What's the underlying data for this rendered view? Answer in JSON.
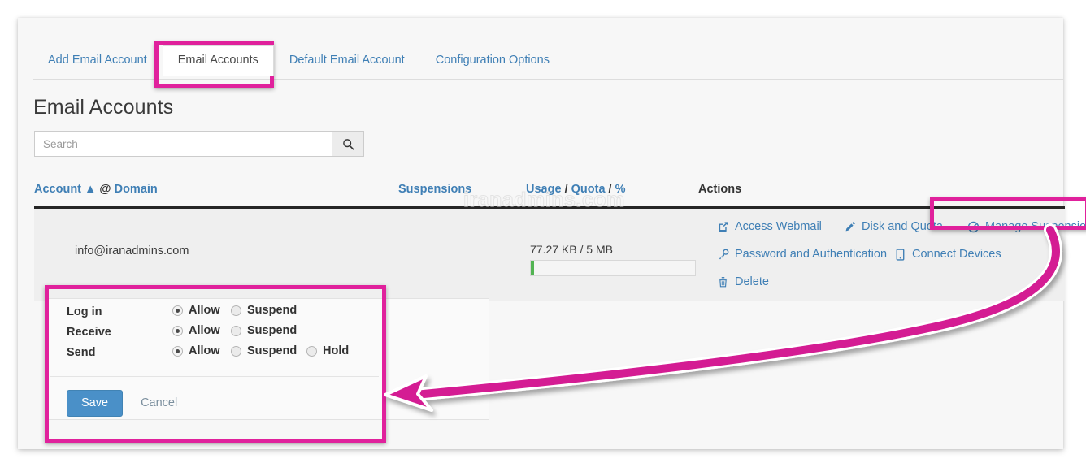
{
  "tabs": [
    {
      "label": "Add Email Account",
      "active": false
    },
    {
      "label": "Email Accounts",
      "active": true
    },
    {
      "label": "Default Email Account",
      "active": false
    },
    {
      "label": "Configuration Options",
      "active": false
    }
  ],
  "page": {
    "title": "Email Accounts",
    "watermark": "iranadmins.com"
  },
  "search": {
    "placeholder": "Search",
    "value": "",
    "icon": "search-icon"
  },
  "table": {
    "headers": {
      "account": "Account ▲",
      "account_at": "@",
      "account_domain": "Domain",
      "suspensions": "Suspensions",
      "usage": "Usage",
      "usage_sep1": "/",
      "quota": "Quota",
      "usage_sep2": "/",
      "percent": "%",
      "actions": "Actions"
    },
    "rows": [
      {
        "email": "info@iranadmins.com",
        "suspensions": "",
        "usage_text": "77.27 KB / 5 MB",
        "usage_percent": 2,
        "actions": [
          {
            "label": "Access Webmail",
            "icon": "external-link-icon"
          },
          {
            "label": "Disk and Quota",
            "icon": "pencil-icon"
          },
          {
            "label": "Manage Suspension",
            "icon": "ban-icon"
          },
          {
            "label": "Password and Authentication",
            "icon": "key-icon"
          },
          {
            "label": "Connect Devices",
            "icon": "mobile-icon"
          },
          {
            "label": "Delete",
            "icon": "trash-icon"
          }
        ]
      }
    ]
  },
  "suspension_form": {
    "rows": [
      {
        "label": "Log in",
        "options": [
          {
            "label": "Allow",
            "selected": true
          },
          {
            "label": "Suspend",
            "selected": false
          }
        ]
      },
      {
        "label": "Receive",
        "options": [
          {
            "label": "Allow",
            "selected": true
          },
          {
            "label": "Suspend",
            "selected": false
          }
        ]
      },
      {
        "label": "Send",
        "options": [
          {
            "label": "Allow",
            "selected": true
          },
          {
            "label": "Suspend",
            "selected": false
          },
          {
            "label": "Hold",
            "selected": false
          }
        ]
      }
    ],
    "save_label": "Save",
    "cancel_label": "Cancel"
  },
  "colors": {
    "link": "#3f7fb5",
    "annotation": "#e0219c",
    "save_button": "#4a90c8",
    "usage_bar": "#53b453"
  }
}
